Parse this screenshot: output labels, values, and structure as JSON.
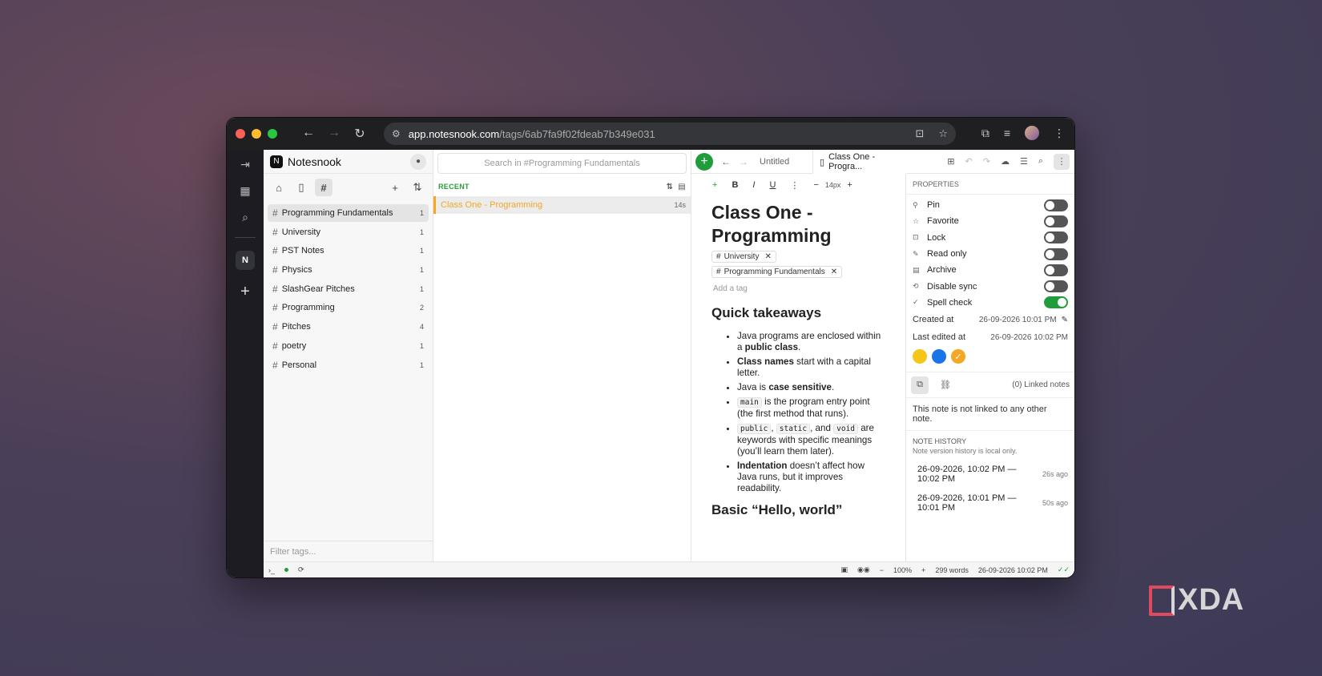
{
  "browser": {
    "url_host": "app.notesnook.com",
    "url_path": "/tags/6ab7fa9f02fdeab7b349e031"
  },
  "app": {
    "name": "Notesnook"
  },
  "tags": {
    "items": [
      {
        "label": "Programming Fundamentals",
        "count": "1"
      },
      {
        "label": "University",
        "count": "1"
      },
      {
        "label": "PST Notes",
        "count": "1"
      },
      {
        "label": "Physics",
        "count": "1"
      },
      {
        "label": "SlashGear Pitches",
        "count": "1"
      },
      {
        "label": "Programming",
        "count": "2"
      },
      {
        "label": "Pitches",
        "count": "4"
      },
      {
        "label": "poetry",
        "count": "1"
      },
      {
        "label": "Personal",
        "count": "1"
      }
    ],
    "filter_placeholder": "Filter tags..."
  },
  "notes": {
    "search_placeholder": "Search in #Programming Fundamentals",
    "section": "RECENT",
    "items": [
      {
        "title": "Class One - Programming",
        "age": "14s"
      }
    ]
  },
  "editor": {
    "tab_untitled": "Untitled",
    "tab_active": "Class One - Progra...",
    "font_size": "14px",
    "title": "Class One - Programming",
    "tag_chips": [
      "University",
      "Programming Fundamentals"
    ],
    "add_tag": "Add a tag",
    "heading1": "Quick takeaways",
    "heading2": "Basic “Hello, world”"
  },
  "properties": {
    "header": "PROPERTIES",
    "toggles": [
      {
        "label": "Pin",
        "on": false
      },
      {
        "label": "Favorite",
        "on": false
      },
      {
        "label": "Lock",
        "on": false
      },
      {
        "label": "Read only",
        "on": false
      },
      {
        "label": "Archive",
        "on": false
      },
      {
        "label": "Disable sync",
        "on": false
      },
      {
        "label": "Spell check",
        "on": true
      }
    ],
    "created_label": "Created at",
    "created_value": "26-09-2026 10:01 PM",
    "edited_label": "Last edited at",
    "edited_value": "26-09-2026 10:02 PM",
    "colors": [
      "#f5c518",
      "#1a73e8",
      "#f5a623"
    ],
    "linked_text": "(0) Linked notes",
    "not_linked": "This note is not linked to any other note.",
    "history_header": "NOTE HISTORY",
    "history_sub": "Note version history is local only.",
    "history": [
      {
        "range": "26-09-2026, 10:02 PM — 10:02 PM",
        "ago": "26s ago"
      },
      {
        "range": "26-09-2026, 10:01 PM — 10:01 PM",
        "ago": "50s ago"
      }
    ]
  },
  "status": {
    "zoom": "100%",
    "words": "299 words",
    "timestamp": "26-09-2026 10:02 PM"
  },
  "watermark": "XDA"
}
